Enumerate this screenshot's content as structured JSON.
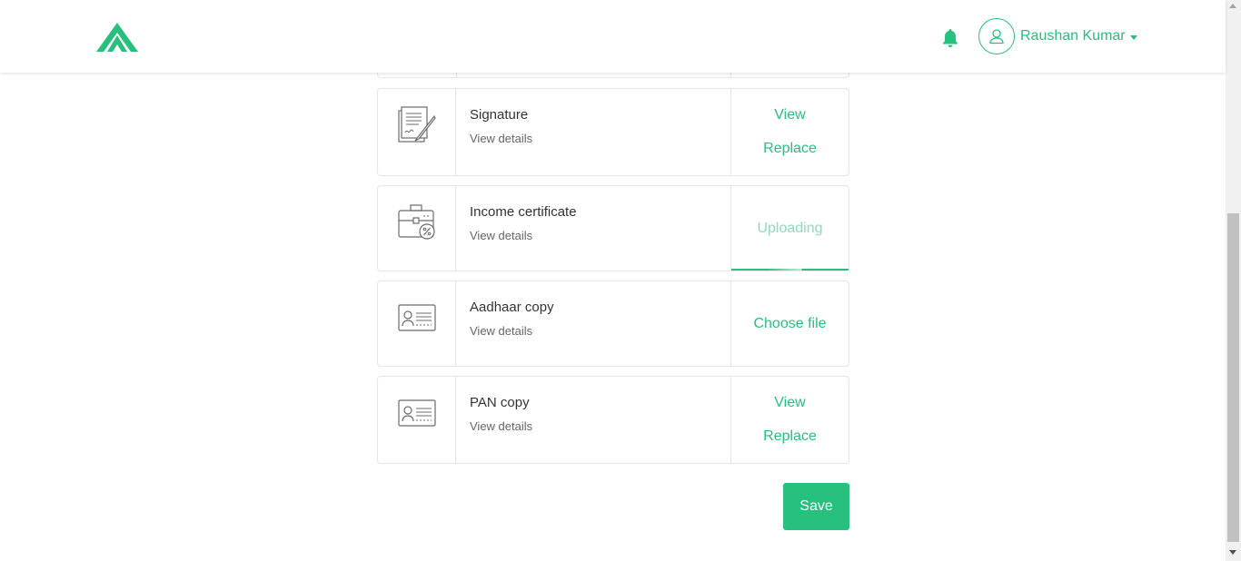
{
  "header": {
    "user_name": "Raushan Kumar",
    "logo_icon": "logo-mountain-icon",
    "notification_icon": "bell-icon",
    "avatar_icon": "user-icon"
  },
  "documents": [
    {
      "title": "Signature",
      "details": "View details",
      "icon": "signature-document-icon",
      "view": "View",
      "replace": "Replace"
    },
    {
      "title": "Income certificate",
      "details": "View details",
      "icon": "briefcase-percent-icon",
      "status": "Uploading",
      "progress": 0.7
    },
    {
      "title": "Aadhaar copy",
      "details": "View details",
      "icon": "id-card-icon",
      "action": "Choose file"
    },
    {
      "title": "PAN copy",
      "details": "View details",
      "icon": "id-card-icon",
      "view": "View",
      "replace": "Replace"
    }
  ],
  "save_label": "Save",
  "colors": {
    "accent": "#27c07d",
    "accent_light": "#8fdcb8",
    "border": "#e6e6e6"
  }
}
